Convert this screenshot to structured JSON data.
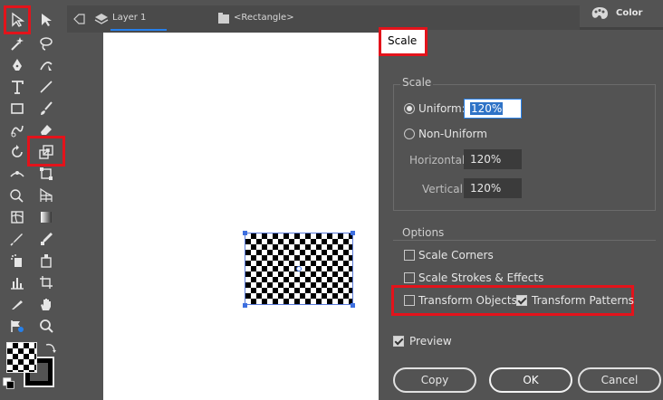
{
  "tabbar": {
    "layer_label": "Layer 1",
    "object_label": "<Rectangle>"
  },
  "right_panel": {
    "color_label": "Color"
  },
  "dialog": {
    "title": "Scale",
    "scale_group_label": "Scale",
    "uniform_label": "Uniform:",
    "uniform_value": "120%",
    "non_uniform_label": "Non-Uniform",
    "horizontal_label": "Horizontal:",
    "horizontal_value": "120%",
    "vertical_label": "Vertical:",
    "vertical_value": "120%",
    "options_label": "Options",
    "scale_corners_label": "Scale Corners",
    "scale_strokes_label": "Scale Strokes & Effects",
    "transform_objects_label": "Transform Objects",
    "transform_patterns_label": "Transform Patterns",
    "preview_label": "Preview",
    "copy_label": "Copy",
    "ok_label": "OK",
    "cancel_label": "Cancel",
    "uniform_selected": true,
    "scale_corners_checked": false,
    "scale_strokes_checked": false,
    "transform_objects_checked": false,
    "transform_patterns_checked": true,
    "preview_checked": true
  },
  "colors": {
    "highlight": "#e3131b",
    "accent": "#2680eb",
    "panel_bg": "#535353",
    "canvas": "#ffffff"
  }
}
